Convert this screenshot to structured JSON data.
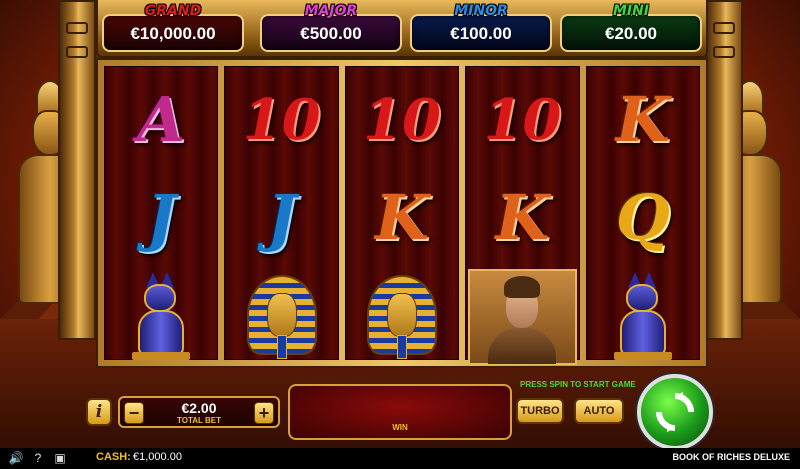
{
  "jackpots": {
    "grand": {
      "name": "GRAND",
      "value": "€10,000.00",
      "color": "#e01a1a"
    },
    "major": {
      "name": "MAJOR",
      "value": "€500.00",
      "color": "#e83ad8"
    },
    "minor": {
      "name": "MINOR",
      "value": "€100.00",
      "color": "#2a8ae8"
    },
    "mini": {
      "name": "MINI",
      "value": "€20.00",
      "color": "#3ad83a"
    }
  },
  "reels": [
    [
      "A",
      "J",
      "cat"
    ],
    [
      "10",
      "J",
      "pharaoh"
    ],
    [
      "10",
      "K",
      "pharaoh"
    ],
    [
      "10",
      "K",
      "explorer"
    ],
    [
      "K",
      "Q",
      "cat"
    ]
  ],
  "controls": {
    "info_label": "i",
    "minus_label": "−",
    "plus_label": "+",
    "bet_value": "€2.00",
    "bet_label": "TOTAL BET",
    "win_label": "WIN",
    "prompt": "PRESS SPIN TO START GAME",
    "turbo_label": "TURBO",
    "auto_label": "AUTO"
  },
  "footer": {
    "cash_label": "CASH:",
    "cash_value": "€1,000.00",
    "game_title": "BOOK OF RICHES DELUXE",
    "icons": [
      "volume-icon",
      "help-icon",
      "fullscreen-icon"
    ]
  },
  "colors": {
    "spin_button": "#1a9a1a",
    "accent_gold": "#e8b030",
    "prompt_green": "#4adc3a"
  }
}
